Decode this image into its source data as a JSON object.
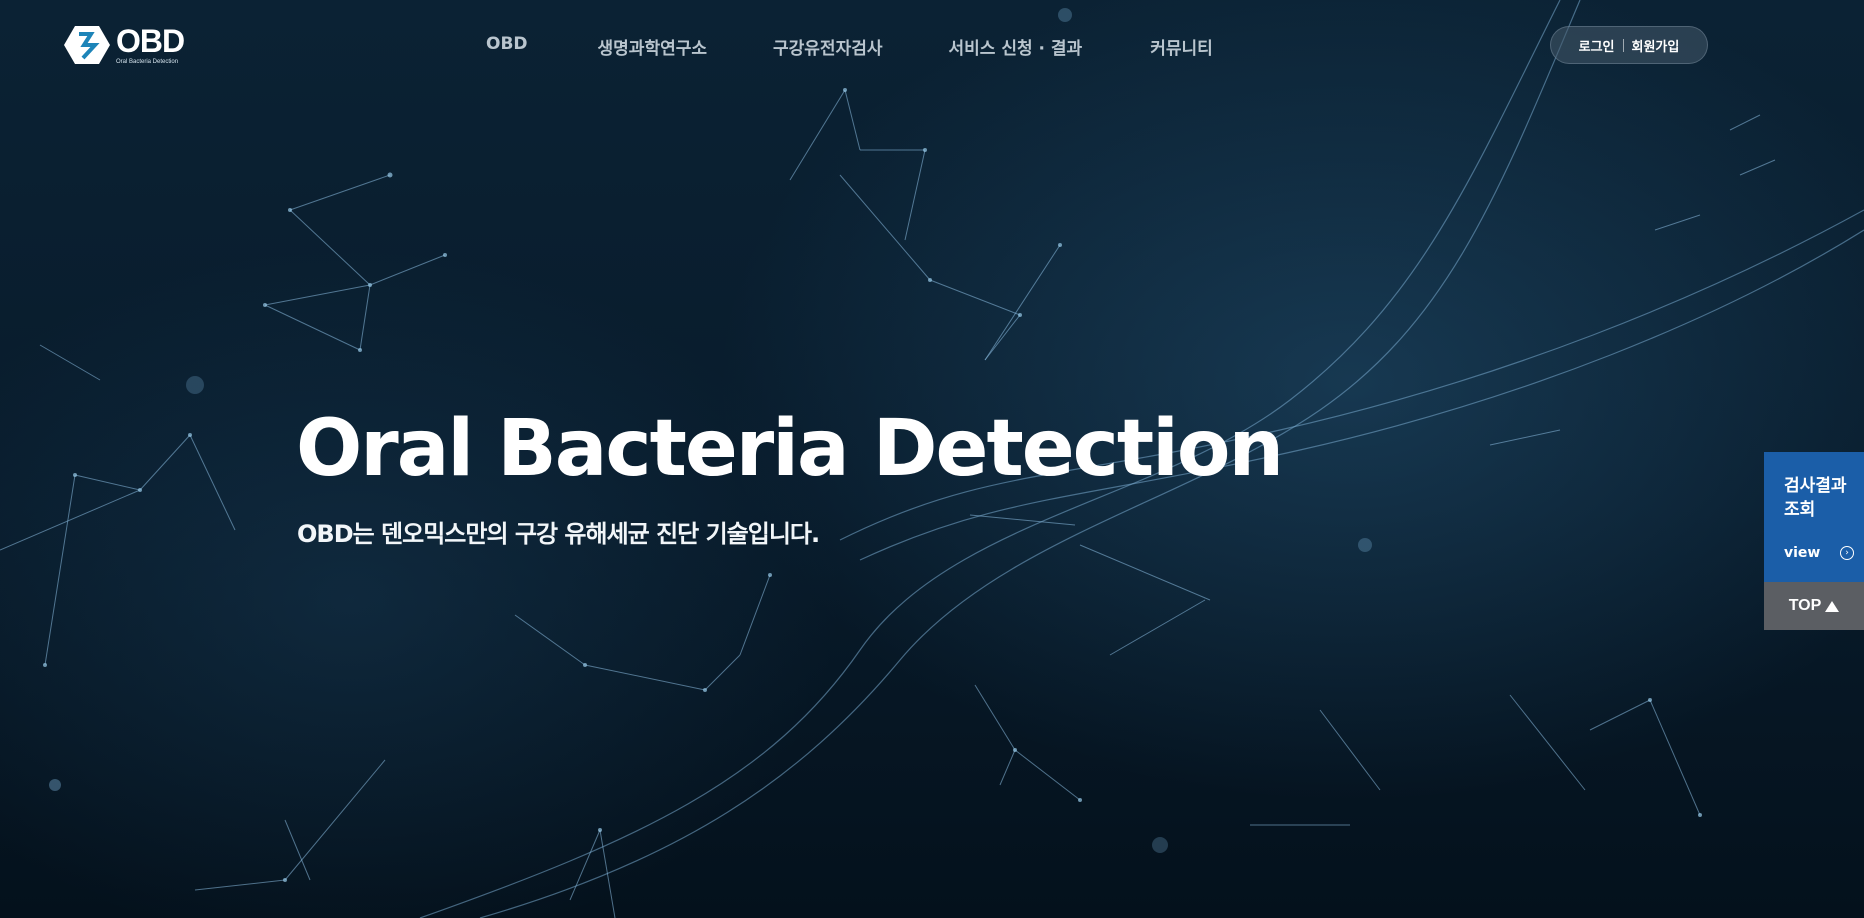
{
  "header": {
    "logo": {
      "word": "OBD",
      "sub": "Oral Bacteria Detection"
    },
    "nav": [
      "OBD",
      "생명과학연구소",
      "구강유전자검사",
      "서비스 신청 · 결과",
      "커뮤니티"
    ],
    "member": {
      "login": "로그인",
      "join": "회원가입"
    }
  },
  "hero": {
    "title": "Oral Bacteria Detection",
    "subtitle": "OBD는 덴오믹스만의 구강 유해세균 진단 기술입니다."
  },
  "quick_menu": {
    "result_title": "검사결과 조회",
    "view_label": "view",
    "top_label": "TOP"
  },
  "colors": {
    "background": "#061726",
    "quick_result": "#1b5ea8",
    "quick_top": "#5b5e63",
    "nav_text": "#b9c5ce"
  }
}
